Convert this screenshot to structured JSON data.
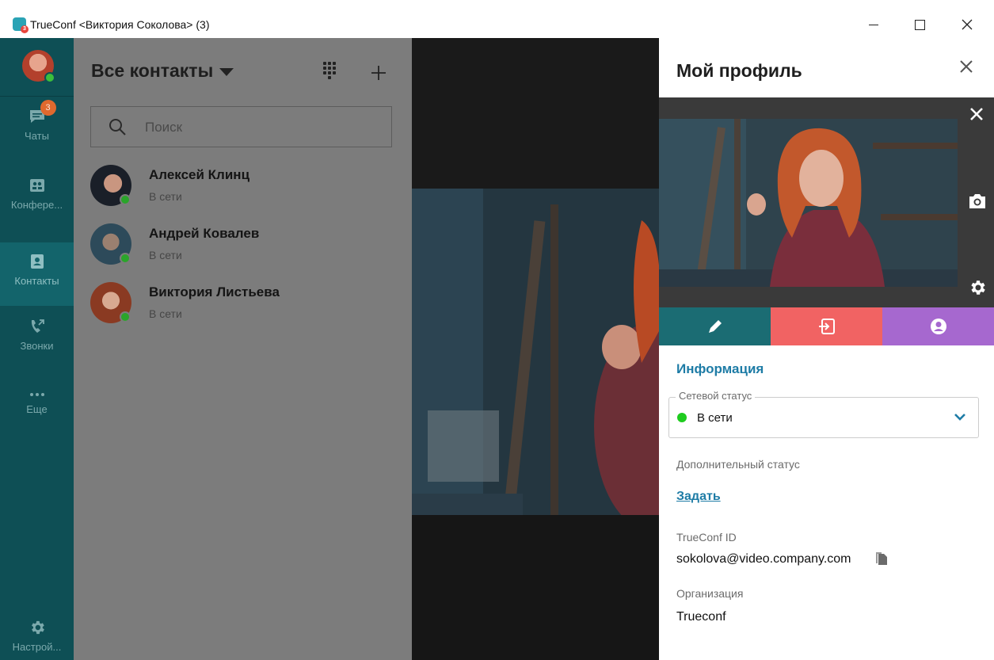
{
  "window": {
    "title": "TrueConf <Виктория Соколова> (3)",
    "app_badge": "3"
  },
  "rail": {
    "items": [
      {
        "label": "Чаты",
        "badge": "3",
        "icon": "chat-icon"
      },
      {
        "label": "Конфере...",
        "icon": "conference-icon"
      },
      {
        "label": "Контакты",
        "icon": "contacts-icon",
        "active": true
      },
      {
        "label": "Звонки",
        "icon": "calls-icon"
      },
      {
        "label": "Еще",
        "icon": "more-icon"
      }
    ],
    "settings_label": "Настрой..."
  },
  "contacts": {
    "title": "Все контакты",
    "search_placeholder": "Поиск",
    "list": [
      {
        "name": "Алексей Клинц",
        "status": "В сети"
      },
      {
        "name": "Андрей Ковалев",
        "status": "В сети"
      },
      {
        "name": "Виктория Листьева",
        "status": "В сети"
      }
    ]
  },
  "profile": {
    "title": "Мой профиль",
    "section_title": "Информация",
    "network_status_label": "Сетевой статус",
    "network_status_value": "В сети",
    "extra_status_label": "Дополнительный статус",
    "set_link": "Задать",
    "trueconf_id_label": "TrueConf ID",
    "trueconf_id_value": "sokolova@video.company.com",
    "organization_label": "Организация",
    "organization_value": "Trueconf"
  },
  "colors": {
    "rail_bg": "#0e4f55",
    "rail_active": "#13646b",
    "accent": "#1e7ca6",
    "online": "#1fcc1f",
    "edit_btn": "#1b6c73",
    "exit_btn": "#f16363",
    "profile_btn": "#a668cf",
    "badge": "#e0692e"
  }
}
